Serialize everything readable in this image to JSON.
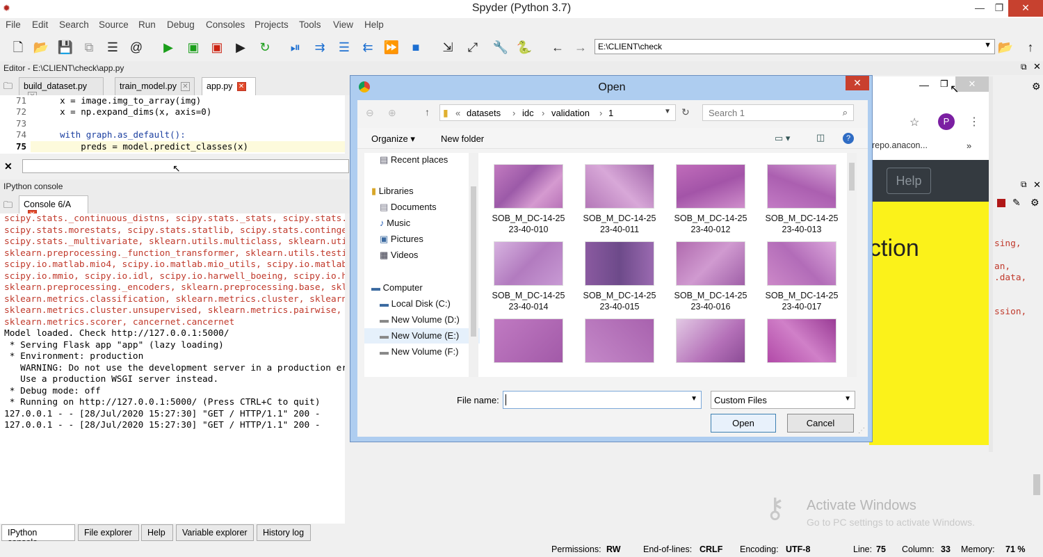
{
  "app": {
    "title": "Spyder (Python 3.7)"
  },
  "menu": [
    "File",
    "Edit",
    "Search",
    "Source",
    "Run",
    "Debug",
    "Consoles",
    "Projects",
    "Tools",
    "View",
    "Help"
  ],
  "toolbar": {
    "path": "E:\\CLIENT\\check"
  },
  "editor": {
    "header": "Editor - E:\\CLIENT\\check\\app.py",
    "tabs": [
      "build_dataset.py",
      "train_model.py",
      "app.py"
    ],
    "lines": [
      {
        "n": "71",
        "code": "    x = image.img_to_array(img)"
      },
      {
        "n": "72",
        "code": "    x = np.expand_dims(x, axis=0)"
      },
      {
        "n": "73",
        "code": ""
      },
      {
        "n": "74",
        "code": "    with graph.as_default():"
      },
      {
        "n": "75",
        "code": "        preds = model.predict_classes(x)"
      }
    ]
  },
  "console": {
    "header": "IPython console",
    "tab": "Console 6/A",
    "red_lines": [
      "scipy.stats._continuous_distns, scipy.stats._stats, scipy.stats.",
      "scipy.stats.morestats, scipy.stats.statlib, scipy.stats.continge",
      "scipy.stats._multivariate, sklearn.utils.multiclass, sklearn.uti",
      "sklearn.preprocessing._function_transformer, sklearn.utils.testi",
      "scipy.io.matlab.mio4, scipy.io.matlab.mio_utils, scipy.io.matlab",
      "scipy.io.mmio, scipy.io.idl, scipy.io.harwell_boeing, scipy.io.h",
      "sklearn.preprocessing._encoders, sklearn.preprocessing.base, skl",
      "sklearn.metrics.classification, sklearn.metrics.cluster, sklearn",
      "sklearn.metrics.cluster.unsupervised, sklearn.metrics.pairwise, ",
      "sklearn.metrics.scorer, cancernet.cancernet"
    ],
    "lines": [
      "Model loaded. Check http://127.0.0.1:5000/",
      " * Serving Flask app \"app\" (lazy loading)",
      " * Environment: production",
      "   WARNING: Do not use the development server in a production er",
      "   Use a production WSGI server instead.",
      " * Debug mode: off",
      " * Running on http://127.0.0.1:5000/ (Press CTRL+C to quit)",
      "127.0.0.1 - - [28/Jul/2020 15:27:30] \"GET / HTTP/1.1\" 200 -",
      "127.0.0.1 - - [28/Jul/2020 15:27:30] \"GET / HTTP/1.1\" 200 -"
    ],
    "right_fragments": [
      "sing,",
      "an,",
      ".data,",
      "ssion,"
    ]
  },
  "bottom_tabs": [
    "IPython console",
    "File explorer",
    "Help",
    "Variable explorer",
    "History log"
  ],
  "status": {
    "permissions_label": "Permissions:",
    "permissions": "RW",
    "eol_label": "End-of-lines:",
    "eol": "CRLF",
    "encoding_label": "Encoding:",
    "encoding": "UTF-8",
    "line_label": "Line:",
    "line": "75",
    "column_label": "Column:",
    "column": "33",
    "memory_label": "Memory:",
    "memory": "71 %"
  },
  "browser": {
    "avatar": "P",
    "bookmark": "repo.anacon...",
    "help_button": "Help",
    "heading_fragment": "ction"
  },
  "watermark": {
    "title": "Activate Windows",
    "subtitle": "Go to PC settings to activate Windows."
  },
  "dialog": {
    "title": "Open",
    "breadcrumb": [
      "datasets",
      "idc",
      "validation",
      "1"
    ],
    "search_placeholder": "Search 1",
    "organize": "Organize",
    "new_folder": "New folder",
    "nav": [
      "Recent places",
      "Libraries",
      "Documents",
      "Music",
      "Pictures",
      "Videos",
      "Computer",
      "Local Disk (C:)",
      "New Volume (D:)",
      "New Volume (E:)",
      "New Volume (F:)"
    ],
    "files": [
      {
        "l1": "SOB_M_DC-14-25",
        "l2": "23-40-010"
      },
      {
        "l1": "SOB_M_DC-14-25",
        "l2": "23-40-011"
      },
      {
        "l1": "SOB_M_DC-14-25",
        "l2": "23-40-012"
      },
      {
        "l1": "SOB_M_DC-14-25",
        "l2": "23-40-013"
      },
      {
        "l1": "SOB_M_DC-14-25",
        "l2": "23-40-014"
      },
      {
        "l1": "SOB_M_DC-14-25",
        "l2": "23-40-015"
      },
      {
        "l1": "SOB_M_DC-14-25",
        "l2": "23-40-016"
      },
      {
        "l1": "SOB_M_DC-14-25",
        "l2": "23-40-017"
      }
    ],
    "filename_label": "File name:",
    "filename_value": "",
    "filter": "Custom Files",
    "open": "Open",
    "cancel": "Cancel"
  }
}
